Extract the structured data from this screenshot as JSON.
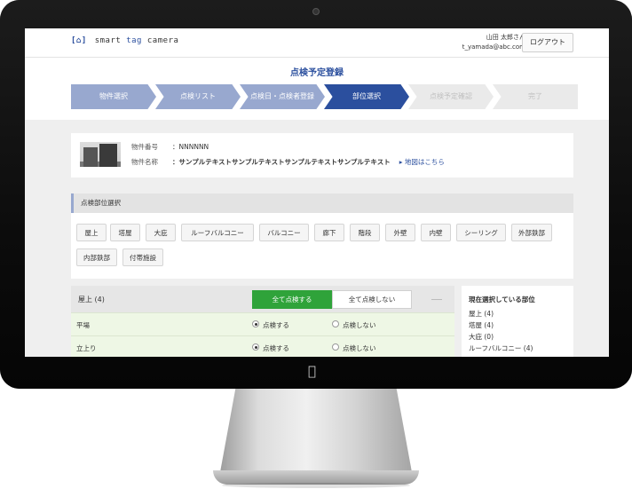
{
  "header": {
    "logo_icon": "[⌂]",
    "logo_text_1": "smart",
    "logo_text_2": "tag",
    "logo_text_3": "camera",
    "user_name": "山田 太郎さん",
    "user_email": "t_yamada@abc.com",
    "logout_label": "ログアウト"
  },
  "page_title": "点検予定登録",
  "steps": [
    {
      "label": "物件選択",
      "state": "done"
    },
    {
      "label": "点検リスト",
      "state": "done"
    },
    {
      "label": "点検日・点検者登録",
      "state": "done"
    },
    {
      "label": "部位選択",
      "state": "active"
    },
    {
      "label": "点検予定確認",
      "state": "todo"
    },
    {
      "label": "完了",
      "state": "todo"
    }
  ],
  "property": {
    "number_label": "物件番号",
    "number_value": "：NNNNNN",
    "name_label": "物件名称",
    "name_value": "：サンプルテキストサンプルテキストサンプルテキストサンプルテキスト",
    "map_link": "▸ 地図はこちら"
  },
  "parts_section": {
    "title": "点検部位選択",
    "chips": [
      "屋上",
      "塔屋",
      "大庇",
      "ルーフバルコニー",
      "バルコニー",
      "廊下",
      "階段",
      "外壁",
      "内壁",
      "シーリング",
      "外部鉄部",
      "内部鉄部",
      "付帯施設"
    ]
  },
  "table": {
    "title": "屋上 (4)",
    "check_all": "全て点検する",
    "check_none": "全て点検しない",
    "rows": [
      {
        "name": "平場",
        "yes": "点検する",
        "no": "点検しない"
      },
      {
        "name": "立上り",
        "yes": "点検する",
        "no": "点検しない"
      }
    ]
  },
  "selected_panel": {
    "title": "現在選択している部位",
    "items": [
      "屋上 (4)",
      "塔屋 (4)",
      "大庇 (0)",
      "ルーフバルコニー (4)"
    ]
  },
  "colors": {
    "accent": "#2b4f9e",
    "step_done": "#98a8cf",
    "green_button": "#2fa33a",
    "row_bg": "#eef7e5"
  },
  "icons": {
    "apple_logo": "apple-icon",
    "camera": "camera-dot"
  }
}
